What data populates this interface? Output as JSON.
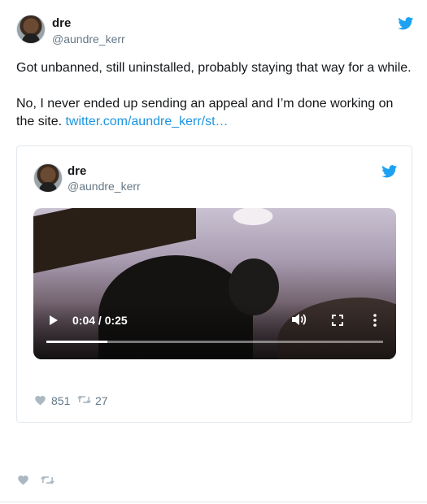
{
  "tweet": {
    "author_name": "dre",
    "author_handle": "@aundre_kerr",
    "text_line1": "Got unbanned, still uninstalled, probably staying that way for a while.",
    "text_line2": "No, I never ended up sending an appeal and I’m done working on the site.",
    "link_text": "twitter.com/aundre_kerr/st…"
  },
  "quoted": {
    "author_name": "dre",
    "author_handle": "@aundre_kerr",
    "video": {
      "time": "0:04 / 0:25",
      "progress": 0.18
    },
    "likes": "851",
    "retweets": "27"
  },
  "colors": {
    "brand": "#1da1f2",
    "link": "#1b95e0",
    "muted": "#657786",
    "border": "#e1e8ed"
  },
  "icons": {
    "logo": "twitter-bird-icon",
    "like": "heart-icon",
    "retweet": "retweet-icon",
    "play": "play-icon",
    "volume": "volume-icon",
    "fullscreen": "fullscreen-icon",
    "more": "more-vertical-icon"
  }
}
